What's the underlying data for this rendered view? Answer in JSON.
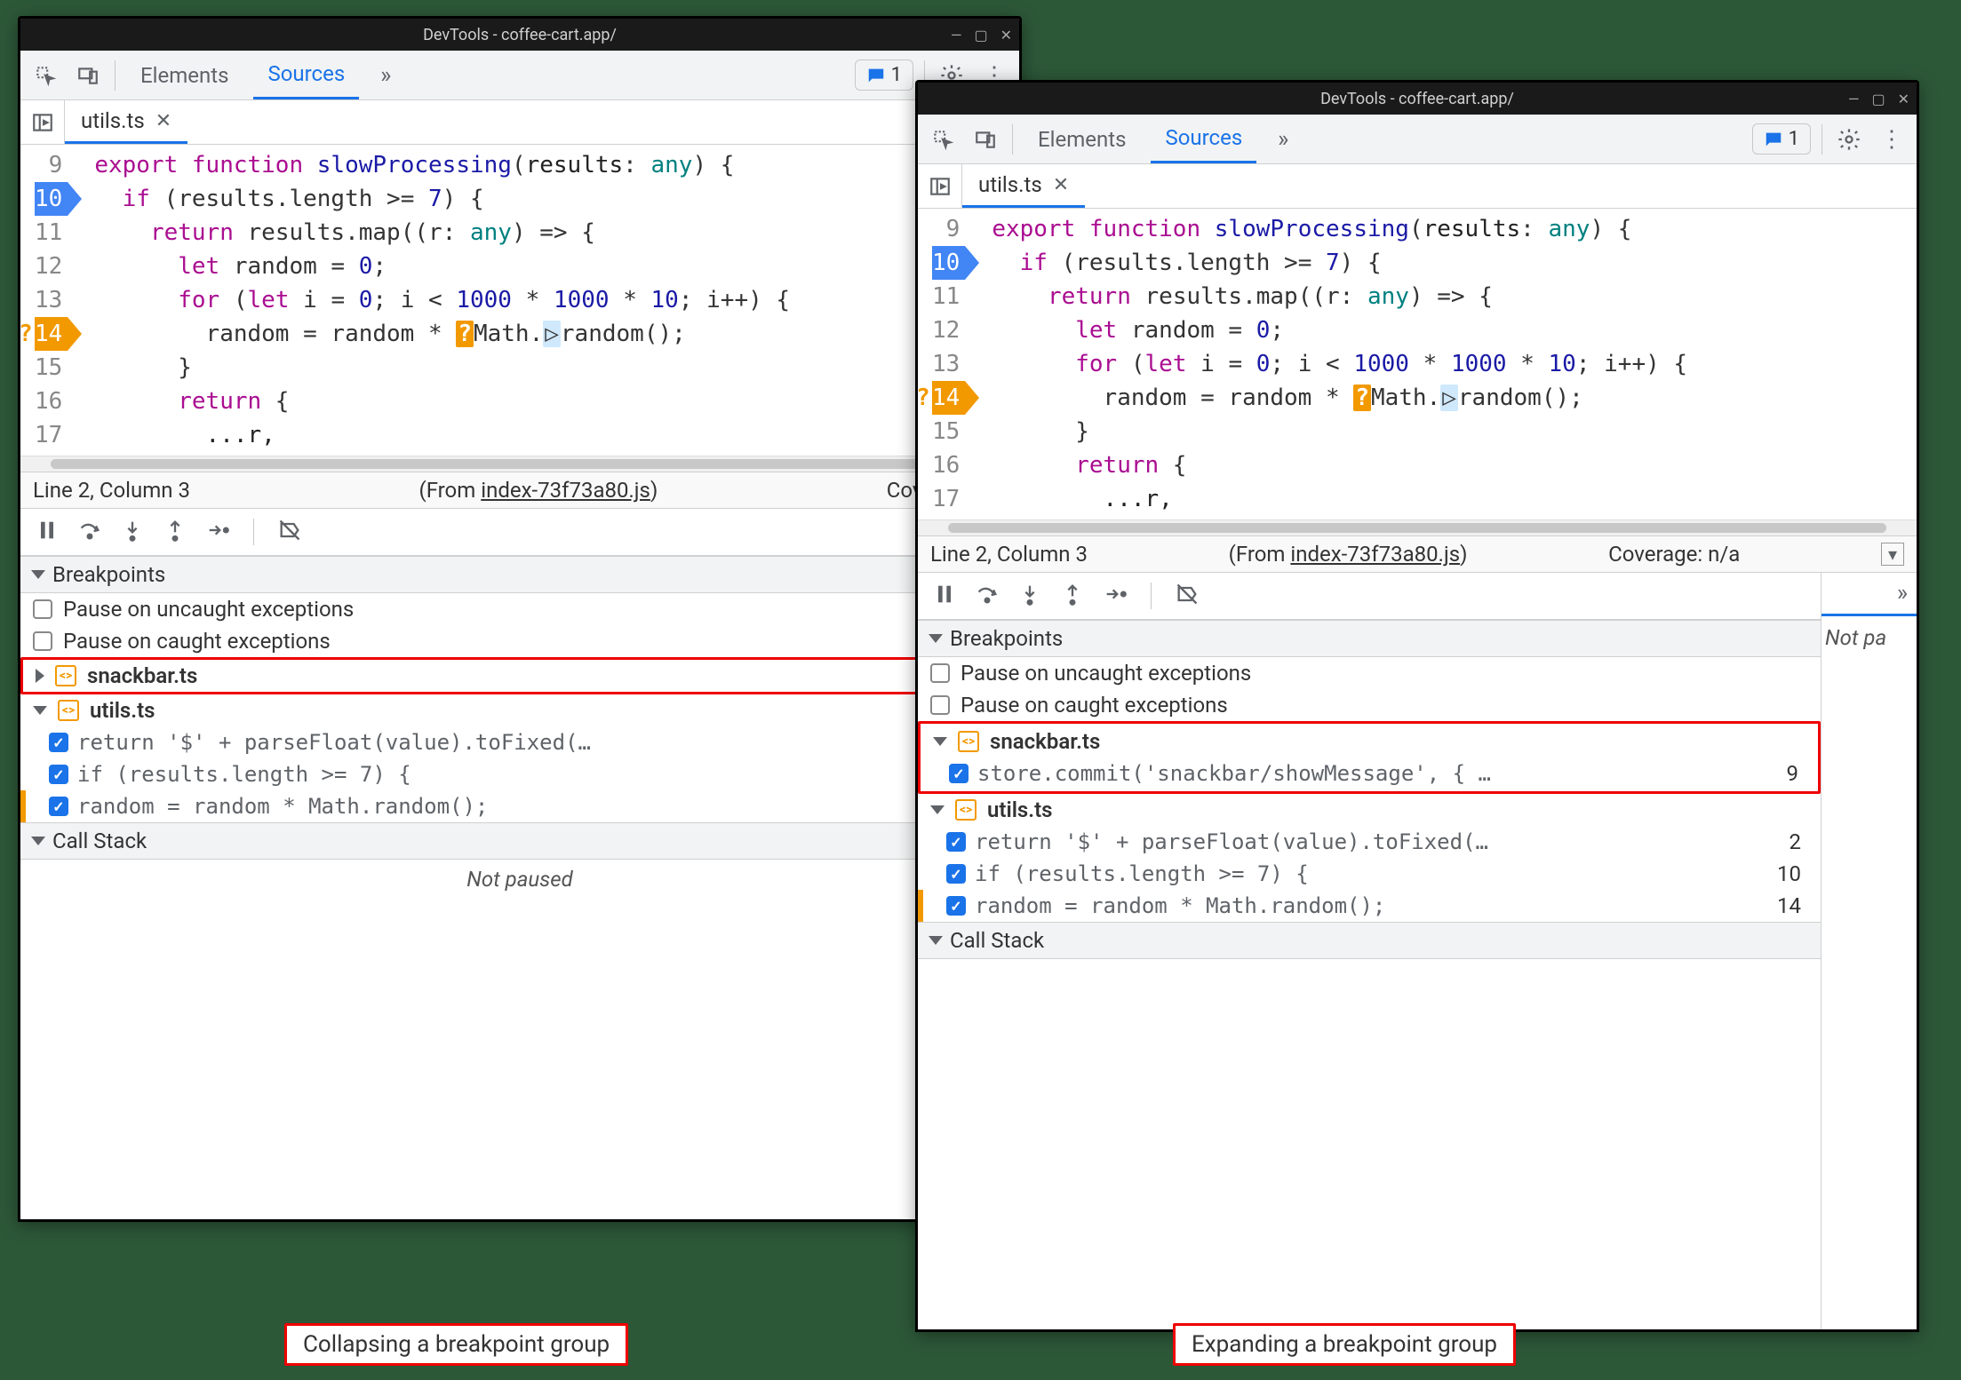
{
  "background_color": "#2d5838",
  "window_title": "DevTools - coffee-cart.app/",
  "tabs": {
    "elements": "Elements",
    "sources": "Sources"
  },
  "messages_count": "1",
  "file_tab": "utils.ts",
  "code": {
    "lines": [
      {
        "n": "9",
        "html": "<span class='kw-export'>export</span> <span class='kw-func'>function</span> <span class='fn-name'>slowProcessing</span>(<span class='txt'>results</span>: <span class='type'>any</span>) {"
      },
      {
        "n": "10",
        "bp": "blue",
        "html": "  <span class='kw-ctrl'>if</span> (results.length &gt;= <span class='num'>7</span>) {"
      },
      {
        "n": "11",
        "html": "    <span class='kw-ctrl'>return</span> results.map((r: <span class='type'>any</span>) =&gt; {"
      },
      {
        "n": "12",
        "html": "      <span class='kw-let'>let</span> random = <span class='num'>0</span>;"
      },
      {
        "n": "13",
        "html": "      <span class='kw-ctrl'>for</span> (<span class='kw-let'>let</span> i = <span class='num'>0</span>; i &lt; <span class='num'>1000</span> * <span class='num'>1000</span> * <span class='num'>10</span>; i++) {"
      },
      {
        "n": "14",
        "bp": "orange",
        "html": "        random = random * <span class='math-badge'>?</span>Math.<span class='rand-badge'>▷</span>random();"
      },
      {
        "n": "15",
        "html": "      }"
      },
      {
        "n": "16",
        "html": "      <span class='kw-ctrl'>return</span> {"
      },
      {
        "n": "17",
        "html": "        <span class='spread'>...r,</span>"
      }
    ]
  },
  "status": {
    "pos": "Line 2, Column 3",
    "from_prefix": "(From ",
    "from_file": "index-73f73a80.js",
    "from_suffix": ")",
    "coverage_left": "Coverage: n/",
    "coverage_right": "Coverage: n/a"
  },
  "sections": {
    "breakpoints": "Breakpoints",
    "callstack": "Call Stack"
  },
  "pause_opts": {
    "uncaught": "Pause on uncaught exceptions",
    "caught": "Pause on caught exceptions"
  },
  "files": {
    "snackbar": "snackbar.ts",
    "utils": "utils.ts"
  },
  "bp_items": {
    "snackbar1": {
      "code": "store.commit('snackbar/showMessage', { …",
      "line": "9"
    },
    "utils1": {
      "code": "return '$' + parseFloat(value).toFixed(…",
      "line": "2"
    },
    "utils2": {
      "code": "if (results.length >= 7) {",
      "line": "10"
    },
    "utils3": {
      "code": "random = random * Math.random();",
      "line": "14"
    }
  },
  "not_paused": "Not paused",
  "not_paused_short": "Not pa",
  "captions": {
    "left": "Collapsing a breakpoint group",
    "right": "Expanding a breakpoint group"
  }
}
